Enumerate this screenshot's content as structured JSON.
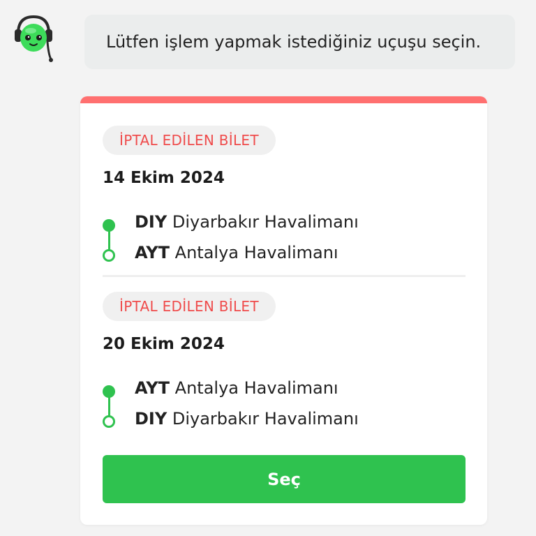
{
  "assistant": {
    "avatar_icon": "support-bot-headset-icon",
    "message": "Lütfen işlem yapmak istediğiniz uçuşu seçin."
  },
  "colors": {
    "accent_green": "#2fc24f",
    "cancel_red": "#ef4b4b",
    "card_top_bar": "#ff7070"
  },
  "flights": [
    {
      "status": "İPTAL EDİLEN BİLET",
      "date": "14 Ekim 2024",
      "origin": {
        "code": "DIY",
        "name": "Diyarbakır Havalimanı"
      },
      "destination": {
        "code": "AYT",
        "name": "Antalya Havalimanı"
      }
    },
    {
      "status": "İPTAL EDİLEN BİLET",
      "date": "20 Ekim 2024",
      "origin": {
        "code": "AYT",
        "name": "Antalya Havalimanı"
      },
      "destination": {
        "code": "DIY",
        "name": "Diyarbakır Havalimanı"
      }
    }
  ],
  "actions": {
    "select_label": "Seç"
  }
}
